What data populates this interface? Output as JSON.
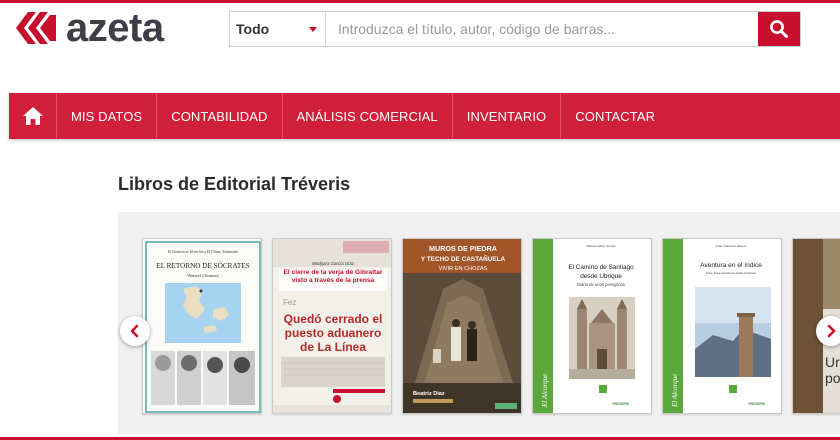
{
  "brand": {
    "name": "azeta",
    "color": "#c8102e"
  },
  "search": {
    "category": "Todo",
    "placeholder": "Introduzca el título, autor, código de barras...",
    "value": ""
  },
  "nav": {
    "home_icon": "home-icon",
    "items": [
      {
        "label": "MIS DATOS"
      },
      {
        "label": "CONTABILIDAD"
      },
      {
        "label": "ANÁLISIS COMERCIAL"
      },
      {
        "label": "INVENTARIO"
      },
      {
        "label": "CONTACTAR"
      }
    ]
  },
  "section": {
    "title": "Libros de Editorial Tréveris"
  },
  "books": [
    {
      "series": "El Cuarteto de Heráclito y El Último Testamento",
      "title": "EL RETORNO DE SÓCRATES",
      "author": "Wenzel Chomsot"
    },
    {
      "author": "Madgara García Díaz",
      "title": "El cierre de la verja de Gibraltar visto a través de la prensa",
      "headline_1": "Quedó cerrado el",
      "headline_2": "puesto aduanero",
      "headline_3": "de La Línea",
      "fragment": "Fez"
    },
    {
      "title_1": "MUROS DE PIEDRA",
      "title_2": "Y TECHO DE CASTAÑUELA",
      "subtitle": "VIVIR EN CHOZAS",
      "author": "Beatriz Díaz"
    },
    {
      "author": "Manuel Ayllón Gómez",
      "title_1": "El Camino de Santiago",
      "title_2": "desde Ubrique",
      "subtitle": "Diario de unos peregrinos",
      "collection": "El Alcorque",
      "publisher": "TREVERIS"
    },
    {
      "author": "Juan Francisco Ramos",
      "title": "Aventura en el índice",
      "subtitle": "Índice, dícese del dedo que señala al horizonte",
      "collection": "El Alcorque",
      "publisher": "TREVERIS"
    },
    {
      "fragment_1": "Ur",
      "fragment_2": "po"
    }
  ],
  "controls": {
    "prev_icon": "chevron-left-icon",
    "next_icon": "chevron-right-icon"
  }
}
